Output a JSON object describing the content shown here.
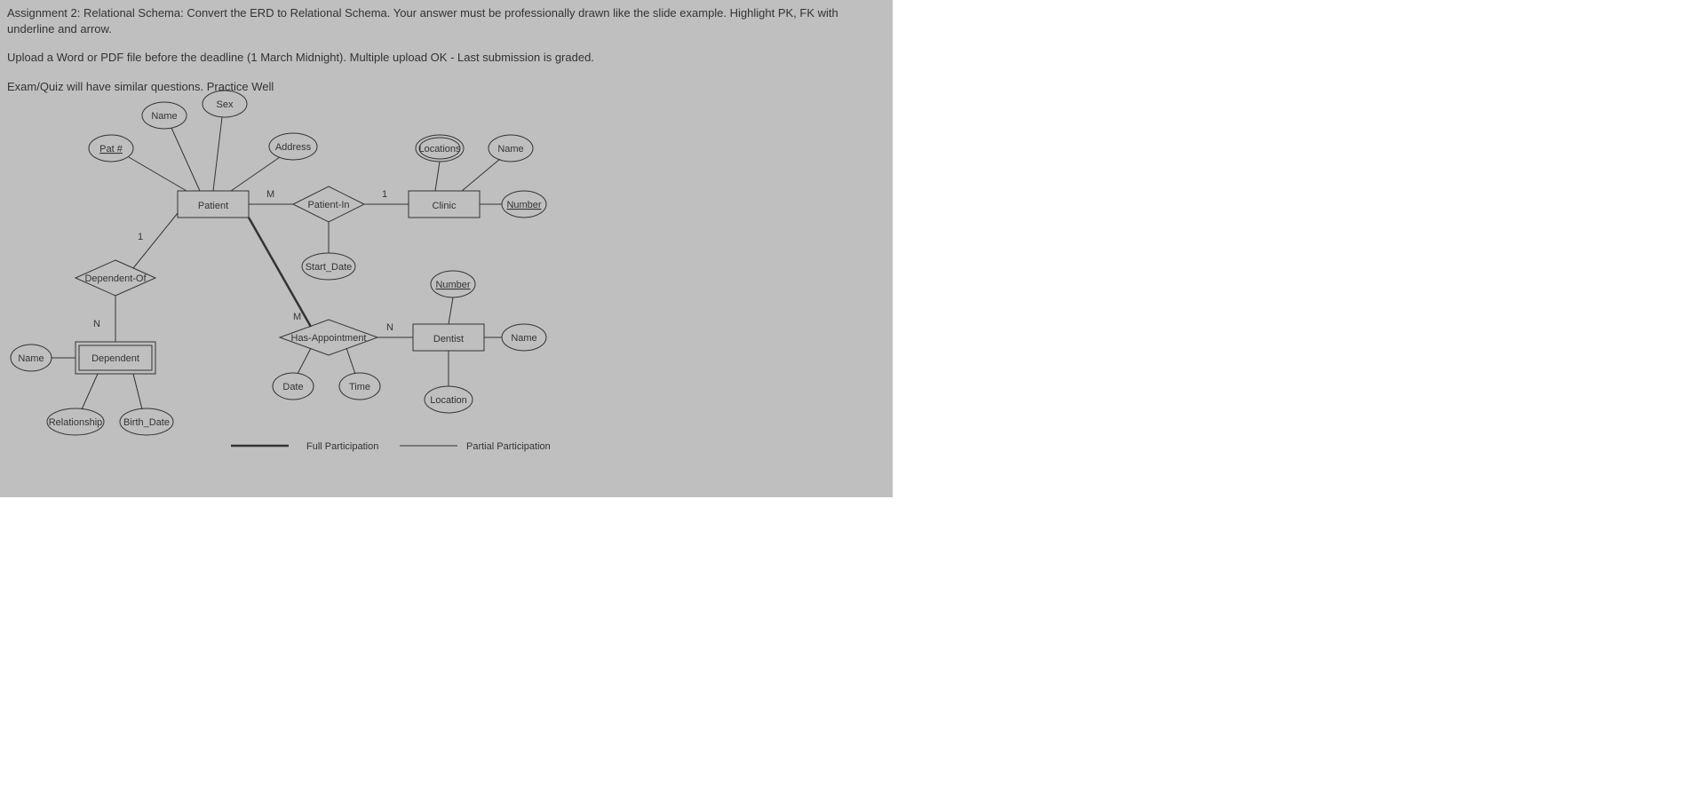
{
  "header": {
    "line1": "Assignment 2: Relational Schema: Convert the ERD to Relational Schema. Your answer must be professionally drawn like the slide example. Highlight PK, FK with underline and arrow.",
    "line2": "Upload a Word or PDF file before the deadline (1 March Midnight). Multiple upload OK - Last submission is graded.",
    "line3": "Exam/Quiz will have similar questions. Practice Well"
  },
  "entities": {
    "patient": "Patient",
    "clinic": "Clinic",
    "dentist": "Dentist",
    "dependent": "Dependent"
  },
  "relationships": {
    "patient_in": "Patient-In",
    "has_appointment": "Has-Appointment",
    "dependent_of": "Dependent-Of"
  },
  "attributes": {
    "patient": {
      "pat_no": "Pat #",
      "name": "Name",
      "sex": "Sex",
      "address": "Address"
    },
    "clinic": {
      "locations": "Locations",
      "name": "Name",
      "number": "Number"
    },
    "dentist": {
      "number": "Number",
      "name": "Name",
      "location": "Location"
    },
    "dependent": {
      "name": "Name",
      "relationship": "Relationship",
      "birth_date": "Birth_Date"
    },
    "patient_in": {
      "start_date": "Start_Date"
    },
    "has_appt": {
      "date": "Date",
      "time": "Time"
    }
  },
  "cardinality": {
    "patient_m": "M",
    "clinic_1": "1",
    "patient_1": "1",
    "dependent_n": "N",
    "appt_m": "M",
    "appt_n": "N"
  },
  "legend": {
    "full": "Full Participation",
    "partial": "Partial Participation"
  }
}
